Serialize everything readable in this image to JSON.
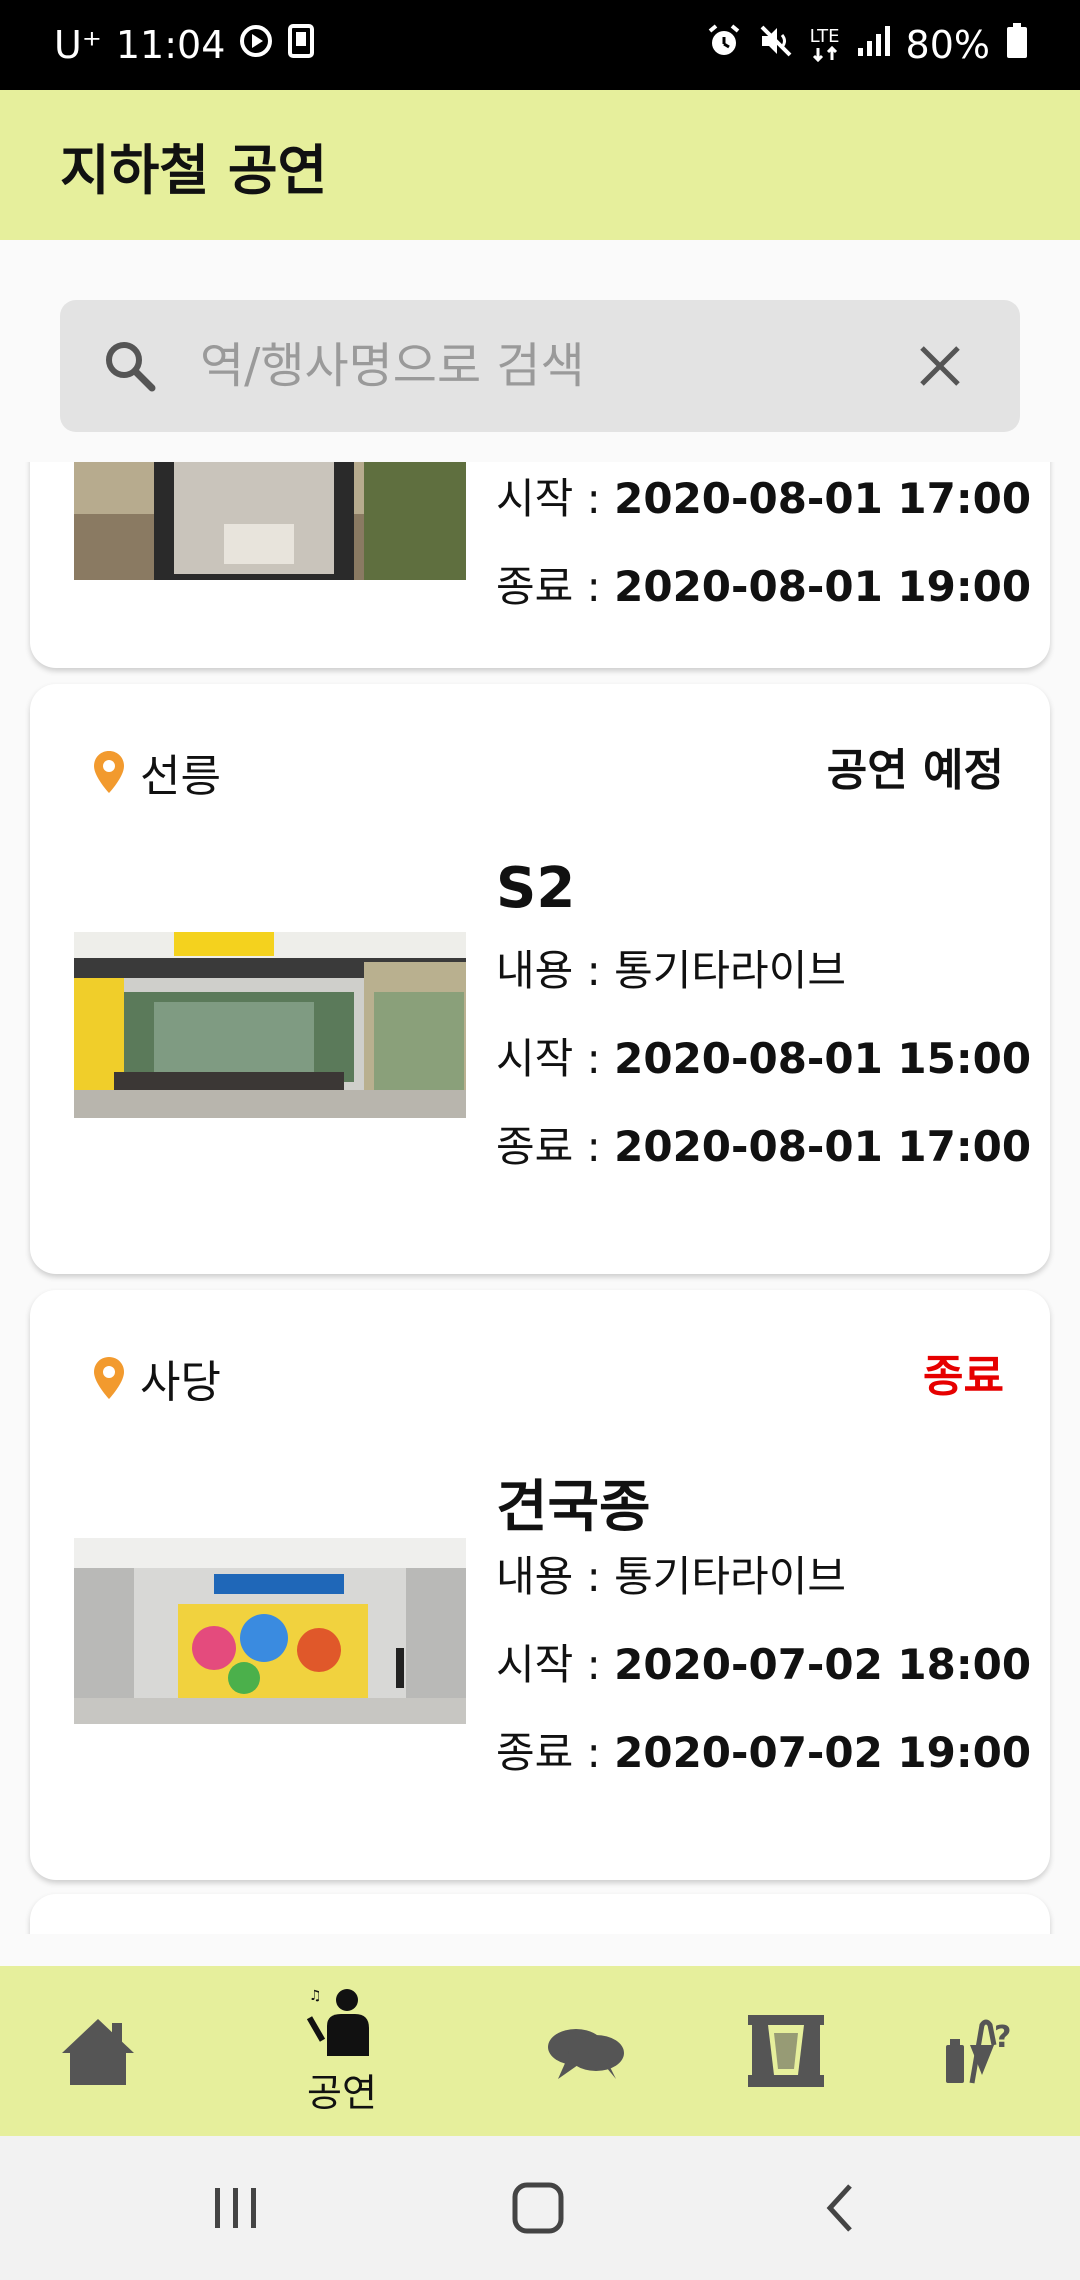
{
  "status_bar": {
    "carrier": "U⁺",
    "time": "11:04",
    "network": "LTE",
    "battery": "80%"
  },
  "app_bar": {
    "title": "지하철 공연"
  },
  "search": {
    "placeholder": "역/행사명으로 검색",
    "value": ""
  },
  "cards": [
    {
      "station": "",
      "status": "",
      "title": "",
      "content": "",
      "start_label": "시작 : ",
      "start": "2020-08-01 17:00",
      "end_label": "종료 : ",
      "end": "2020-08-01 19:00"
    },
    {
      "station": "선릉",
      "status": "공연 예정",
      "status_color": "#111111",
      "title": "S2",
      "content": "내용 : 통기타라이브",
      "start_label": "시작 : ",
      "start": "2020-08-01 15:00",
      "end_label": "종료 : ",
      "end": "2020-08-01 17:00"
    },
    {
      "station": "사당",
      "status": "종료",
      "status_color": "#e60000",
      "title": "견국종",
      "content": "내용 : 통기타라이브",
      "start_label": "시작 : ",
      "start": "2020-07-02 18:00",
      "end_label": "종료 : ",
      "end": "2020-07-02 19:00"
    }
  ],
  "bottom_nav": {
    "items": [
      {
        "icon": "home-icon",
        "label": ""
      },
      {
        "icon": "performer-icon",
        "label": "공연",
        "active": true
      },
      {
        "icon": "chat-icon",
        "label": ""
      },
      {
        "icon": "stage-icon",
        "label": ""
      },
      {
        "icon": "lost-found-icon",
        "label": ""
      }
    ]
  },
  "colors": {
    "accent": "#e6ef9c",
    "pin": "#f29a2e",
    "ended": "#e60000"
  }
}
